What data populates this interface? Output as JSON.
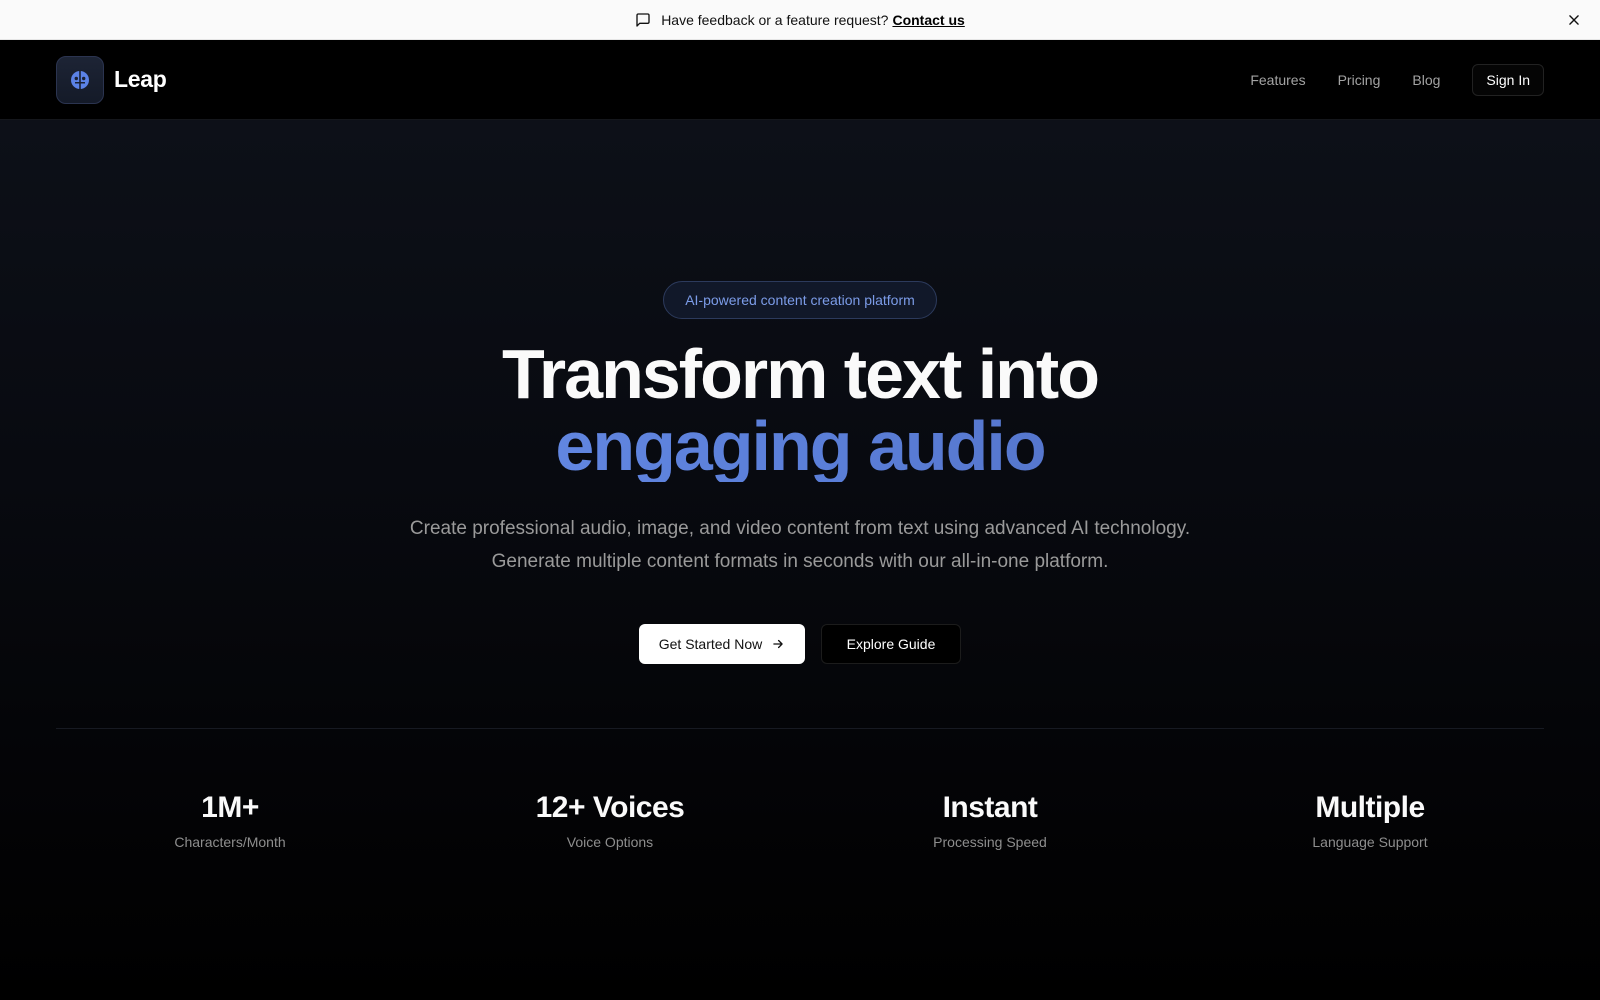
{
  "banner": {
    "message": "Have feedback or a feature request?",
    "link": "Contact us",
    "icon": "chat-bubble-icon",
    "close_icon": "close-icon"
  },
  "header": {
    "brand": "Leap",
    "nav": [
      {
        "label": "Features"
      },
      {
        "label": "Pricing"
      },
      {
        "label": "Blog"
      }
    ],
    "signin": "Sign In"
  },
  "hero": {
    "badge": "AI-powered content creation platform",
    "title_line1": "Transform text into",
    "title_line2": "engaging audio",
    "subtitle": "Create professional audio, image, and video content from text using advanced AI technology. Generate multiple content formats in seconds with our all-in-one platform.",
    "primary_cta": "Get Started Now",
    "secondary_cta": "Explore Guide"
  },
  "stats": [
    {
      "value": "1M+",
      "label": "Characters/Month"
    },
    {
      "value": "12+ Voices",
      "label": "Voice Options"
    },
    {
      "value": "Instant",
      "label": "Processing Speed"
    },
    {
      "value": "Multiple",
      "label": "Language Support"
    }
  ],
  "colors": {
    "accent": "#6f95f0",
    "badge_text": "#7c9ce8",
    "background": "#000000"
  }
}
